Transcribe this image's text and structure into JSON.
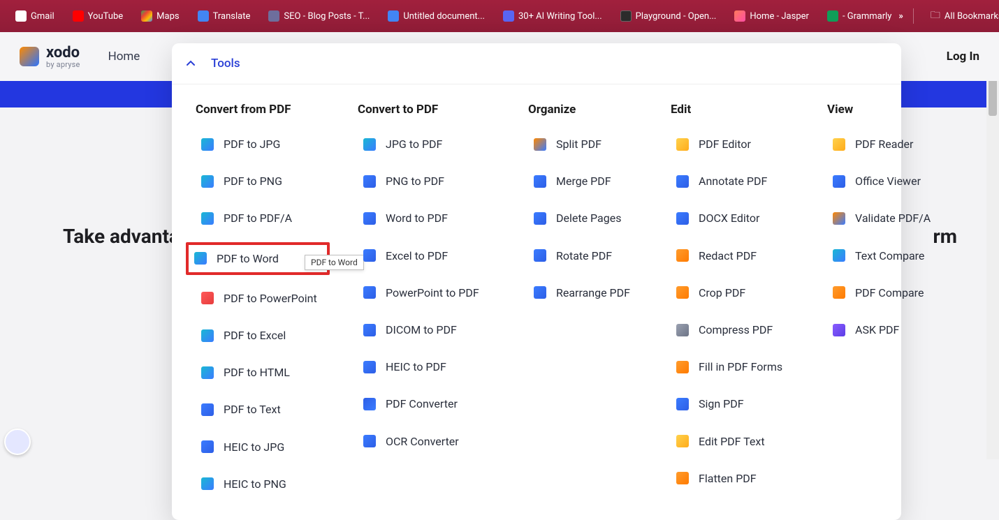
{
  "bookmarks": {
    "items": [
      {
        "label": "Gmail",
        "icon": "gmail"
      },
      {
        "label": "YouTube",
        "icon": "yt"
      },
      {
        "label": "Maps",
        "icon": "maps"
      },
      {
        "label": "Translate",
        "icon": "trans"
      },
      {
        "label": "SEO - Blog Posts - T...",
        "icon": "cloud"
      },
      {
        "label": "Untitled document...",
        "icon": "doc"
      },
      {
        "label": "30+ AI Writing Tool...",
        "icon": "d"
      },
      {
        "label": "Playground - Open...",
        "icon": "op"
      },
      {
        "label": "Home - Jasper",
        "icon": "j"
      },
      {
        "label": "- Grammarly",
        "icon": "g"
      }
    ],
    "overflow": "»",
    "all": "All Bookmarks"
  },
  "brand": {
    "name": "xodo",
    "sub": "by apryse"
  },
  "nav": {
    "home": "Home",
    "tools": "Tools",
    "login": "Log In"
  },
  "bg": {
    "left": "Take advantage",
    "right": "rm"
  },
  "tooltip": "PDF to Word",
  "mega": {
    "header": "Tools",
    "cols": [
      {
        "title": "Convert from PDF",
        "items": [
          "PDF to JPG",
          "PDF to PNG",
          "PDF to PDF/A",
          "PDF to Word",
          "PDF to PowerPoint",
          "PDF to Excel",
          "PDF to HTML",
          "PDF to Text",
          "HEIC to JPG",
          "HEIC to PNG"
        ]
      },
      {
        "title": "Convert to PDF",
        "items": [
          "JPG to PDF",
          "PNG to PDF",
          "Word to PDF",
          "Excel to PDF",
          "PowerPoint to PDF",
          "DICOM to PDF",
          "HEIC to PDF",
          "PDF Converter",
          "OCR Converter"
        ]
      },
      {
        "title": "Organize",
        "items": [
          "Split PDF",
          "Merge PDF",
          "Delete Pages",
          "Rotate PDF",
          "Rearrange PDF"
        ]
      },
      {
        "title": "Edit",
        "items": [
          "PDF Editor",
          "Annotate PDF",
          "DOCX Editor",
          "Redact PDF",
          "Crop PDF",
          "Compress PDF",
          "Fill in PDF Forms",
          "Sign PDF",
          "Edit PDF Text",
          "Flatten PDF"
        ]
      },
      {
        "title": "View",
        "items": [
          "PDF Reader",
          "Office Viewer",
          "Validate PDF/A",
          "Text Compare",
          "PDF Compare",
          "ASK PDF"
        ]
      }
    ]
  }
}
